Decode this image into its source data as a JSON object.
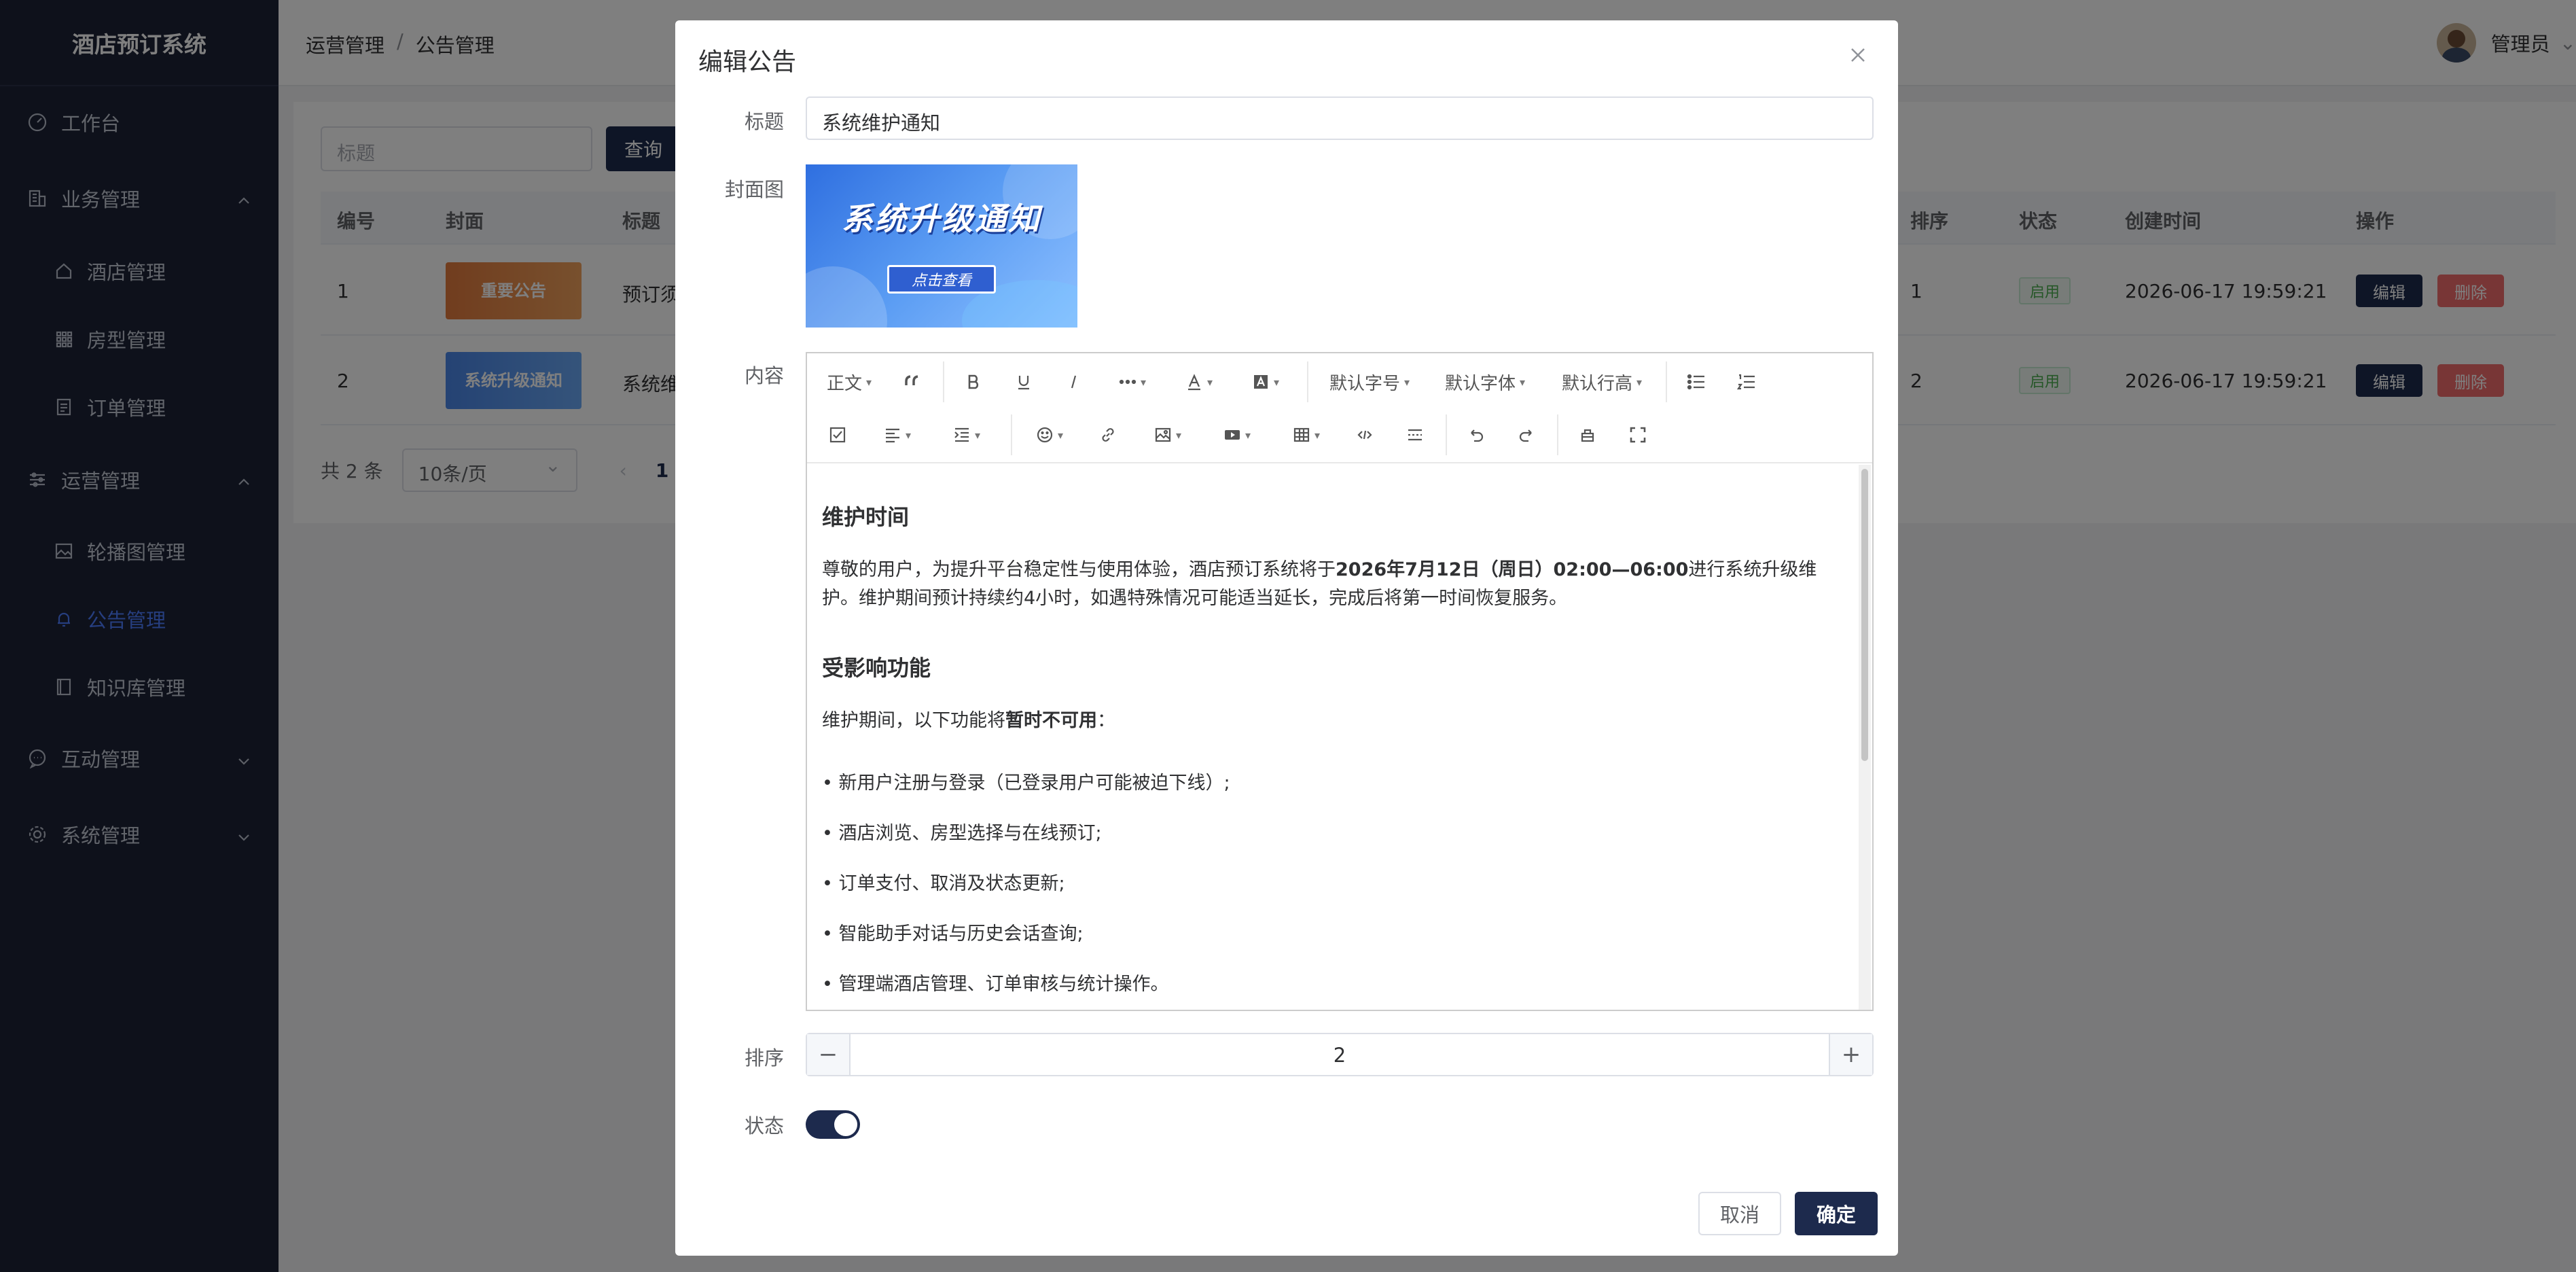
{
  "app": {
    "title": "酒店预订系统"
  },
  "sidebar": {
    "items": [
      {
        "label": "工作台",
        "icon": "dashboard-icon"
      },
      {
        "label": "业务管理",
        "icon": "building-icon",
        "expanded": true,
        "children": [
          {
            "label": "酒店管理",
            "icon": "home-icon"
          },
          {
            "label": "房型管理",
            "icon": "grid-icon"
          },
          {
            "label": "订单管理",
            "icon": "document-icon"
          }
        ]
      },
      {
        "label": "运营管理",
        "icon": "sliders-icon",
        "expanded": true,
        "children": [
          {
            "label": "轮播图管理",
            "icon": "image-icon"
          },
          {
            "label": "公告管理",
            "icon": "bell-icon",
            "active": true
          },
          {
            "label": "知识库管理",
            "icon": "book-icon"
          }
        ]
      },
      {
        "label": "互动管理",
        "icon": "chat-icon",
        "expanded": false
      },
      {
        "label": "系统管理",
        "icon": "gear-icon",
        "expanded": false
      }
    ]
  },
  "header": {
    "breadcrumb": [
      "运营管理",
      "/",
      "公告管理"
    ],
    "user": "管理员"
  },
  "list": {
    "search_placeholder": "标题",
    "query_label": "查询",
    "columns": [
      "编号",
      "封面",
      "标题",
      "排序",
      "状态",
      "创建时间",
      "操作"
    ],
    "rows": [
      {
        "id": "1",
        "cover_text": "重要公告",
        "title": "预订须",
        "sort": "1",
        "status": "启用",
        "created": "2026-06-17 19:59:21",
        "edit": "编辑",
        "delete": "删除"
      },
      {
        "id": "2",
        "cover_text": "系统升级通知",
        "title": "系统维",
        "sort": "2",
        "status": "启用",
        "created": "2026-06-17 19:59:21",
        "edit": "编辑",
        "delete": "删除"
      }
    ],
    "total": "共 2 条",
    "page_size": "10条/页",
    "current_page": "1"
  },
  "dialog": {
    "title": "编辑公告",
    "labels": {
      "title": "标题",
      "cover": "封面图",
      "content": "内容",
      "sort": "排序",
      "status": "状态"
    },
    "title_value": "系统维护通知",
    "cover": {
      "headline": "系统升级通知",
      "button": "点击查看"
    },
    "toolbar": {
      "paragraph": "正文",
      "font_size": "默认字号",
      "font_family": "默认字体",
      "line_height": "默认行高"
    },
    "content": {
      "h1": "维护时间",
      "p1_pre": "尊敬的用户，为提升平台稳定性与使用体验，酒店预订系统将于",
      "p1_bold": "2026年7月12日（周日）02:00—06:00",
      "p1_post": "进行系统升级维护。维护期间预计持续约4小时，如遇特殊情况可能适当延长，完成后将第一时间恢复服务。",
      "h2": "受影响功能",
      "p2_pre": "维护期间，以下功能将",
      "p2_bold": "暂时不可用",
      "p2_post": "：",
      "bullets": [
        "• 新用户注册与登录（已登录用户可能被迫下线）;",
        "• 酒店浏览、房型选择与在线预订;",
        "• 订单支付、取消及状态更新;",
        "• 智能助手对话与历史会话查询;",
        "• 管理端酒店管理、订单审核与统计操作。"
      ]
    },
    "sort_value": "2",
    "sort_minus": "−",
    "sort_plus": "+",
    "status_on": true,
    "cancel_label": "取消",
    "ok_label": "确定"
  },
  "colors": {
    "primary": "#1d2a4d",
    "sidebar_bg": "#1d2236",
    "active_menu": "#4d7cfe",
    "danger": "#f06c6c",
    "success": "#4caf50"
  }
}
